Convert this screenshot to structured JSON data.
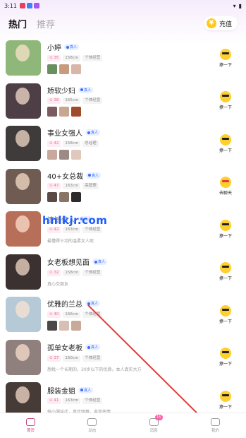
{
  "status": {
    "time": "3:11",
    "app_colors": [
      "#e4405f",
      "#3b82f6",
      "#a855f7"
    ]
  },
  "header": {
    "tab_hot": "热门",
    "tab_recommend": "推荐",
    "recharge_label": "充值",
    "coin_icon": "¥"
  },
  "profiles": [
    {
      "name": "小婷",
      "badge": "真人",
      "age": "35",
      "height": "158cm",
      "tag": "个体经营",
      "photos": true,
      "bio": "",
      "action": "撩一下",
      "avatar": "#8fb77a",
      "thumbs": [
        "#6a8f5e",
        "#c79b7c",
        "#d8b6a8"
      ]
    },
    {
      "name": "娇软少妇",
      "badge": "真人",
      "age": "38",
      "height": "165cm",
      "tag": "个体经营",
      "photos": true,
      "bio": "",
      "action": "撩一下",
      "avatar": "#4e3f47",
      "thumbs": [
        "#7b5b60",
        "#c9a68e",
        "#a04b2a"
      ]
    },
    {
      "name": "事业女强人",
      "badge": "真人",
      "age": "42",
      "height": "158cm",
      "tag": "总经理",
      "photos": true,
      "bio": "",
      "action": "撩一下",
      "avatar": "#3e3b3a",
      "thumbs": [
        "#c8a79c",
        "#9e8a84",
        "#e1c8bd"
      ]
    },
    {
      "name": "40+女总裁",
      "badge": "真人",
      "age": "47",
      "height": "163cm",
      "tag": "高管理",
      "photos": true,
      "bio": "",
      "action": "去聊天",
      "avatar": "#6f5b52",
      "thumbs": [
        "#5b4a44",
        "#8a7466",
        "#2c2a2a"
      ]
    },
    {
      "name": "遗憾佳人",
      "badge": "真人",
      "age": "42",
      "height": "163cm",
      "tag": "个体经营",
      "photos": false,
      "bio": "最懂得三动的温柔女人呢",
      "action": "撩一下",
      "avatar": "#b86f5a",
      "thumbs": []
    },
    {
      "name": "女老板想见面",
      "badge": "真人",
      "age": "32",
      "height": "158cm",
      "tag": "个体经营",
      "photos": false,
      "bio": "真心交朋友",
      "action": "撩一下",
      "avatar": "#3a3130",
      "thumbs": []
    },
    {
      "name": "优雅的兰总",
      "badge": "真人",
      "age": "40",
      "height": "166cm",
      "tag": "个体经营",
      "photos": true,
      "bio": "",
      "action": "撩一下",
      "avatar": "#b5c9d6",
      "thumbs": [
        "#4b4848",
        "#d7bfb3",
        "#c9a99a"
      ]
    },
    {
      "name": "孤单女老板",
      "badge": "真人",
      "age": "37",
      "height": "160cm",
      "tag": "个体经营",
      "photos": false,
      "bio": "想找一个长期的，30岁以下的优质。本人真实大方",
      "action": "撩一下",
      "avatar": "#8f7f7d",
      "thumbs": []
    },
    {
      "name": "服装金姐",
      "badge": "真人",
      "age": "41",
      "height": "163cm",
      "tag": "个体经营",
      "photos": false,
      "bio": "做小服装店，喜欢跳舞，非常热情",
      "action": "撩一下",
      "avatar": "#463b37",
      "thumbs": []
    }
  ],
  "watermark": "hnlkjr.com",
  "bottom_nav": [
    {
      "label": "首页",
      "active": true,
      "badge": ""
    },
    {
      "label": "动态",
      "active": false,
      "badge": ""
    },
    {
      "label": "消息",
      "active": false,
      "badge": "15"
    },
    {
      "label": "我的",
      "active": false,
      "badge": ""
    }
  ],
  "arrow_color": "#e53935"
}
